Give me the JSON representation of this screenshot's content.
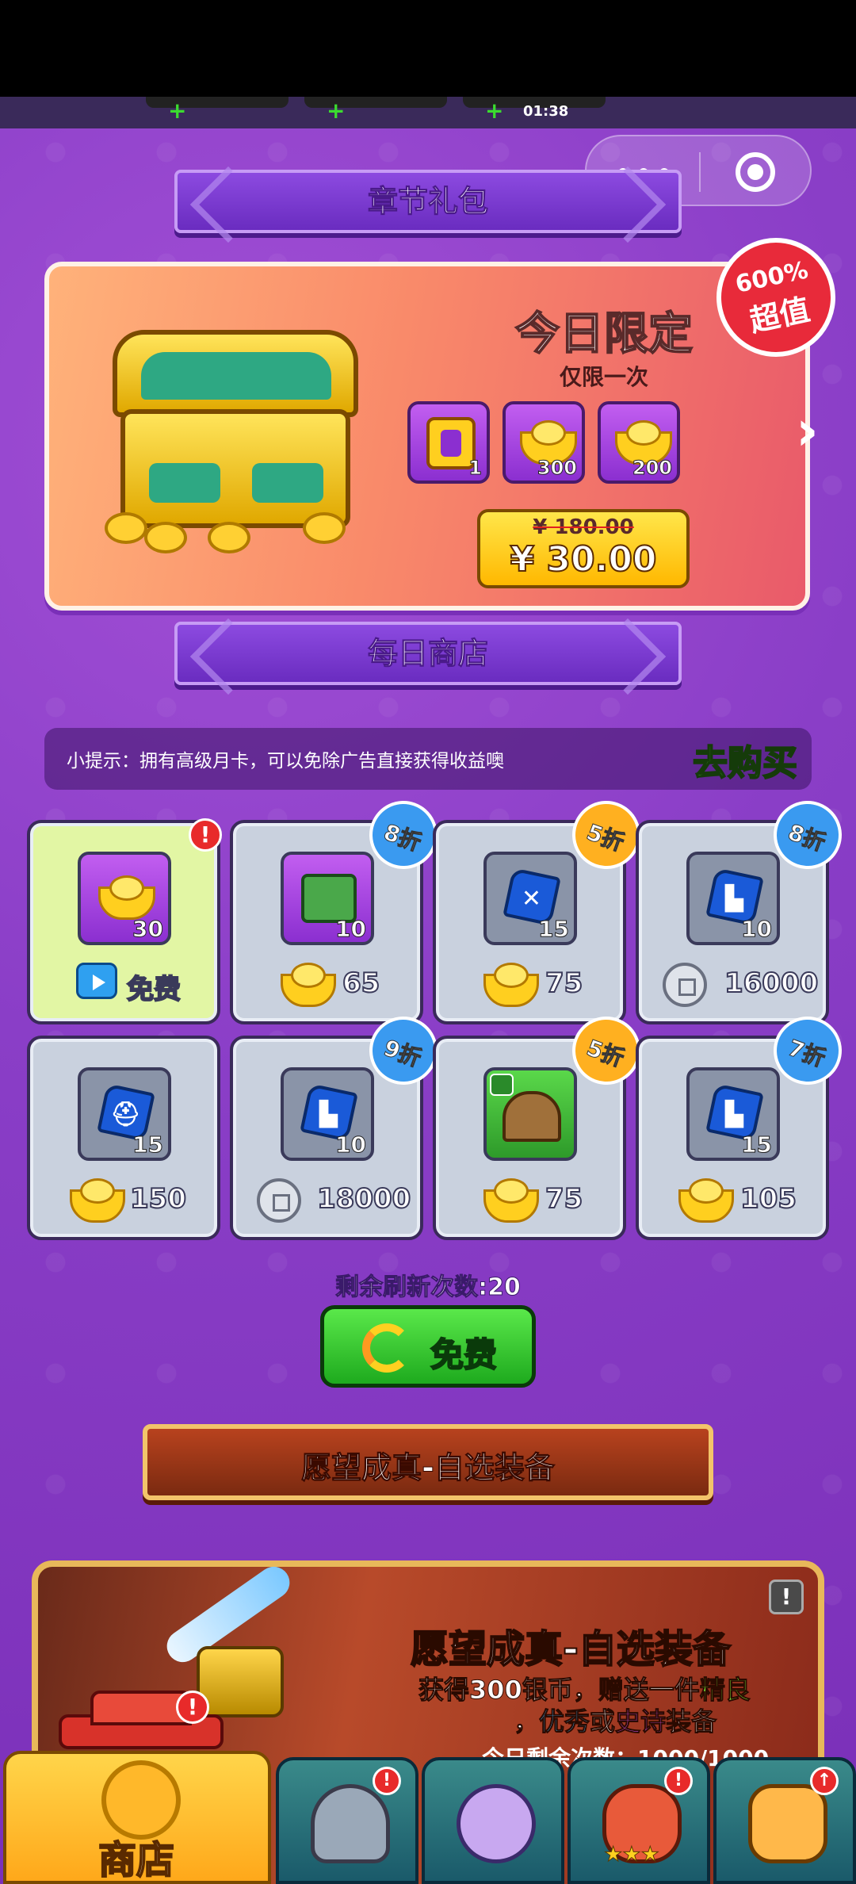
{
  "top_strip": {
    "timer": "01:38",
    "plus_icon": "plus-icon"
  },
  "chapter_pack": {
    "title": "章节礼包"
  },
  "offer": {
    "title": "今日限定",
    "subtitle": "仅限一次",
    "badge_percent": "600%",
    "badge_text": "超值",
    "rewards": [
      {
        "icon": "book-icon",
        "qty": "1"
      },
      {
        "icon": "gold-ingot-icon",
        "qty": "300"
      },
      {
        "icon": "gold-ingot-icon",
        "qty": "200"
      }
    ],
    "old_price": "¥ 180.00",
    "price": "¥ 30.00"
  },
  "daily_shop": {
    "title": "每日商店"
  },
  "tip": {
    "text": "小提示：拥有高级月卡，可以免除广告直接获得收益噢",
    "buy_label": "去购买"
  },
  "shop_items": [
    {
      "icon": "gold-ingot-icon",
      "qty": "30",
      "price_icon": "tv-icon",
      "price": "免费",
      "discount": "",
      "alert": "!"
    },
    {
      "icon": "jade-icon",
      "qty": "10",
      "price_icon": "gold-ingot-icon",
      "price": "65",
      "discount": "8折",
      "alert": ""
    },
    {
      "icon": "blue-gem-icon",
      "qty": "15",
      "price_icon": "gold-ingot-icon",
      "price": "75",
      "discount": "5折",
      "alert": ""
    },
    {
      "icon": "blue-boot-gem-icon",
      "qty": "10",
      "price_icon": "silver-coin-icon",
      "price": "16000",
      "discount": "8折",
      "alert": ""
    },
    {
      "icon": "blue-helmet-gem-icon",
      "qty": "15",
      "price_icon": "gold-ingot-icon",
      "price": "150",
      "discount": "",
      "alert": ""
    },
    {
      "icon": "blue-boot-gem-icon",
      "qty": "10",
      "price_icon": "silver-coin-icon",
      "price": "18000",
      "discount": "9折",
      "alert": ""
    },
    {
      "icon": "hut-icon",
      "qty": "",
      "price_icon": "gold-ingot-icon",
      "price": "75",
      "discount": "5折",
      "alert": ""
    },
    {
      "icon": "blue-boot-gem-icon",
      "qty": "15",
      "price_icon": "gold-ingot-icon",
      "price": "105",
      "discount": "7折",
      "alert": ""
    }
  ],
  "refresh": {
    "count_label": "剩余刷新次数:20",
    "button_label": "免费"
  },
  "wish": {
    "banner": "愿望成真-自选装备",
    "title": "愿望成真-自选装备",
    "desc_prefix": "获得300银币，赠送一件",
    "q1": "精良",
    "desc_comma": "，",
    "q2": "优秀",
    "or": "或",
    "q3": "史诗",
    "desc_suffix": "装备",
    "remaining": "今日剩余次数：1000/1000",
    "info": "!"
  },
  "bottom_nav": {
    "shop_label": "商店",
    "tabs": [
      {
        "name": "helmet-icon",
        "badge": "!"
      },
      {
        "name": "shield-icon",
        "badge": ""
      },
      {
        "name": "chicken-icon",
        "badge": "!"
      },
      {
        "name": "fist-upgrade-icon",
        "badge": "↑"
      }
    ]
  },
  "colors": {
    "background": "#8a3ec7",
    "accent_gold": "#ffcf1f",
    "free_green": "#1eaa1e",
    "alert_red": "#e82a2a"
  }
}
